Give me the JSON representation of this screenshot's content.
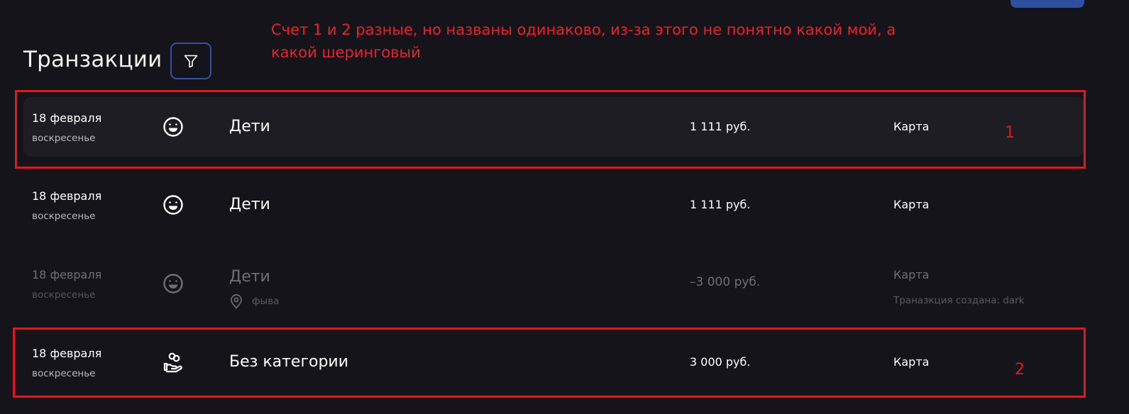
{
  "header": {
    "title": "Транзакции"
  },
  "annotation": {
    "comment": "Счет 1 и 2 разные, но названы одинаково, из-за этого не понятно какой мой, а какой шеринговый",
    "marker_1": "1",
    "marker_2": "2",
    "color": "#e3181f"
  },
  "transactions": [
    {
      "date": "18 февраля",
      "weekday": "воскресенье",
      "category_icon": "smiley-icon",
      "category": "Дети",
      "amount": "1 111 руб.",
      "account": "Карта"
    },
    {
      "date": "18 февраля",
      "weekday": "воскресенье",
      "category_icon": "smiley-icon",
      "category": "Дети",
      "amount": "1 111 руб.",
      "account": "Карта"
    },
    {
      "date": "18 февраля",
      "weekday": "воскресенье",
      "category_icon": "smiley-icon",
      "category": "Дети",
      "place_icon": "location-pin-icon",
      "place": "фыва",
      "amount": "–3 000 руб.",
      "account": "Карта",
      "created_by": "Траназкция создана: dark"
    },
    {
      "date": "18 февраля",
      "weekday": "воскресенье",
      "category_icon": "hand-coins-icon",
      "category": "Без категории",
      "amount": "3 000 руб.",
      "account": "Карта"
    }
  ],
  "colors": {
    "background": "#15141a",
    "row_active": "#1e1d24",
    "accent": "#3451a6"
  }
}
